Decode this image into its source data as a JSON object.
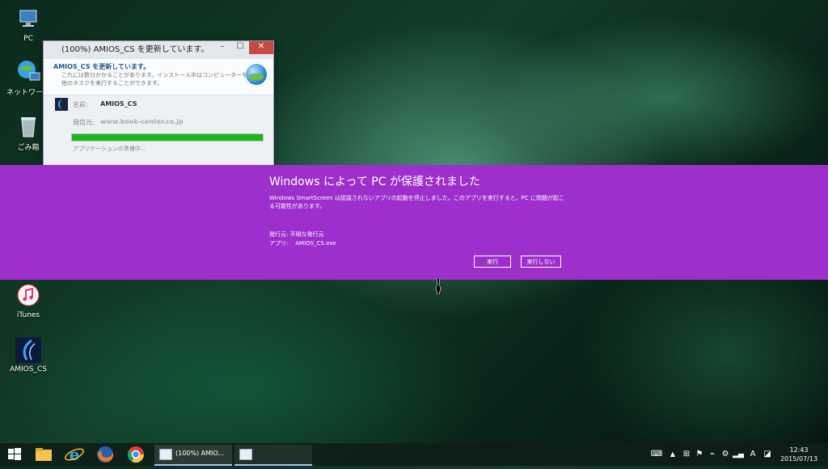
{
  "desktop": {
    "icons": [
      {
        "label": "PC"
      },
      {
        "label": "ネットワーク"
      },
      {
        "label": "ごみ箱"
      },
      {
        "label": "iTunes"
      },
      {
        "label": "AMIOS_CS"
      }
    ]
  },
  "installer": {
    "title": "(100%) AMIOS_CS を更新しています。",
    "header_title": "AMIOS_CS を更新しています。",
    "header_line1": "これには数分かかることがあります。インストール中はコンピューターを使って",
    "header_line2": "他のタスクを実行することができます。",
    "name_label": "名前:",
    "name_value": "AMIOS_CS",
    "publisher_label": "発信元:",
    "publisher_value": "www.book-center.co.jp",
    "progress": 1.0,
    "status": "アプリケーションの準備中..."
  },
  "smartscreen": {
    "title": "Windows によって PC が保護されました",
    "description": "Windows SmartScreen は認識されないアプリの起動を停止しました。このアプリを実行すると、PC に問題が起こる可能性があります。",
    "publisher_label": "発行元:",
    "publisher_value": "不明な発行元",
    "app_label": "アプリ:",
    "app_value": "AMIOS_CS.exe",
    "run_button": "実行",
    "dont_run_button": "実行しない",
    "color": "#9d2fcd"
  },
  "taskbar": {
    "active_window_label": "(100%) AMIO...",
    "ime_mode": "A",
    "time": "12:43",
    "date": "2015/07/13"
  }
}
